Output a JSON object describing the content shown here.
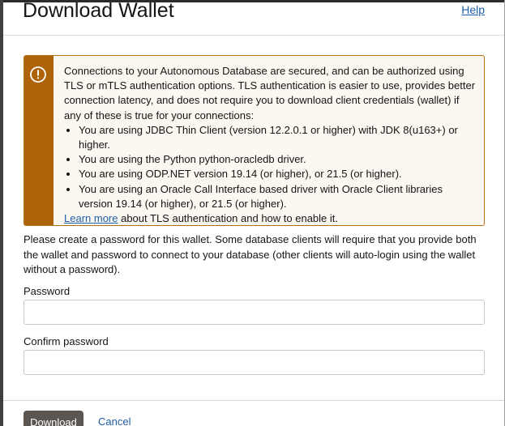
{
  "dialog": {
    "title": "Download Wallet",
    "help_label": "Help"
  },
  "notice": {
    "icon": "warning-circle-icon",
    "intro": "Connections to your Autonomous Database are secured, and can be authorized using TLS or mTLS authentication options. TLS authentication is easier to use, provides better connection latency, and does not require you to download client credentials (wallet) if any of these is true for your connections:",
    "bullets": [
      "You are using JDBC Thin Client (version 12.2.0.1 or higher) with JDK 8(u163+) or higher.",
      "You are using the Python python-oracledb driver.",
      "You are using ODP.NET version 19.14 (or higher), or 21.5 (or higher).",
      "You are using an Oracle Call Interface based driver with Oracle Client libraries version 19.14 (or higher), or 21.5 (or higher)."
    ],
    "learn_more_link": "Learn more",
    "learn_more_suffix": " about TLS authentication and how to enable it."
  },
  "form": {
    "intro": "Please create a password for this wallet. Some database clients will require that you provide both the wallet and password to connect to your database (other clients will auto-login using the wallet without a password).",
    "password_label": "Password",
    "password_value": "",
    "confirm_label": "Confirm password",
    "confirm_value": ""
  },
  "footer": {
    "download_label": "Download",
    "cancel_label": "Cancel"
  },
  "colors": {
    "warning_accent": "#ad6408",
    "link": "#1f5ea8",
    "primary_button": "#5b5652"
  }
}
